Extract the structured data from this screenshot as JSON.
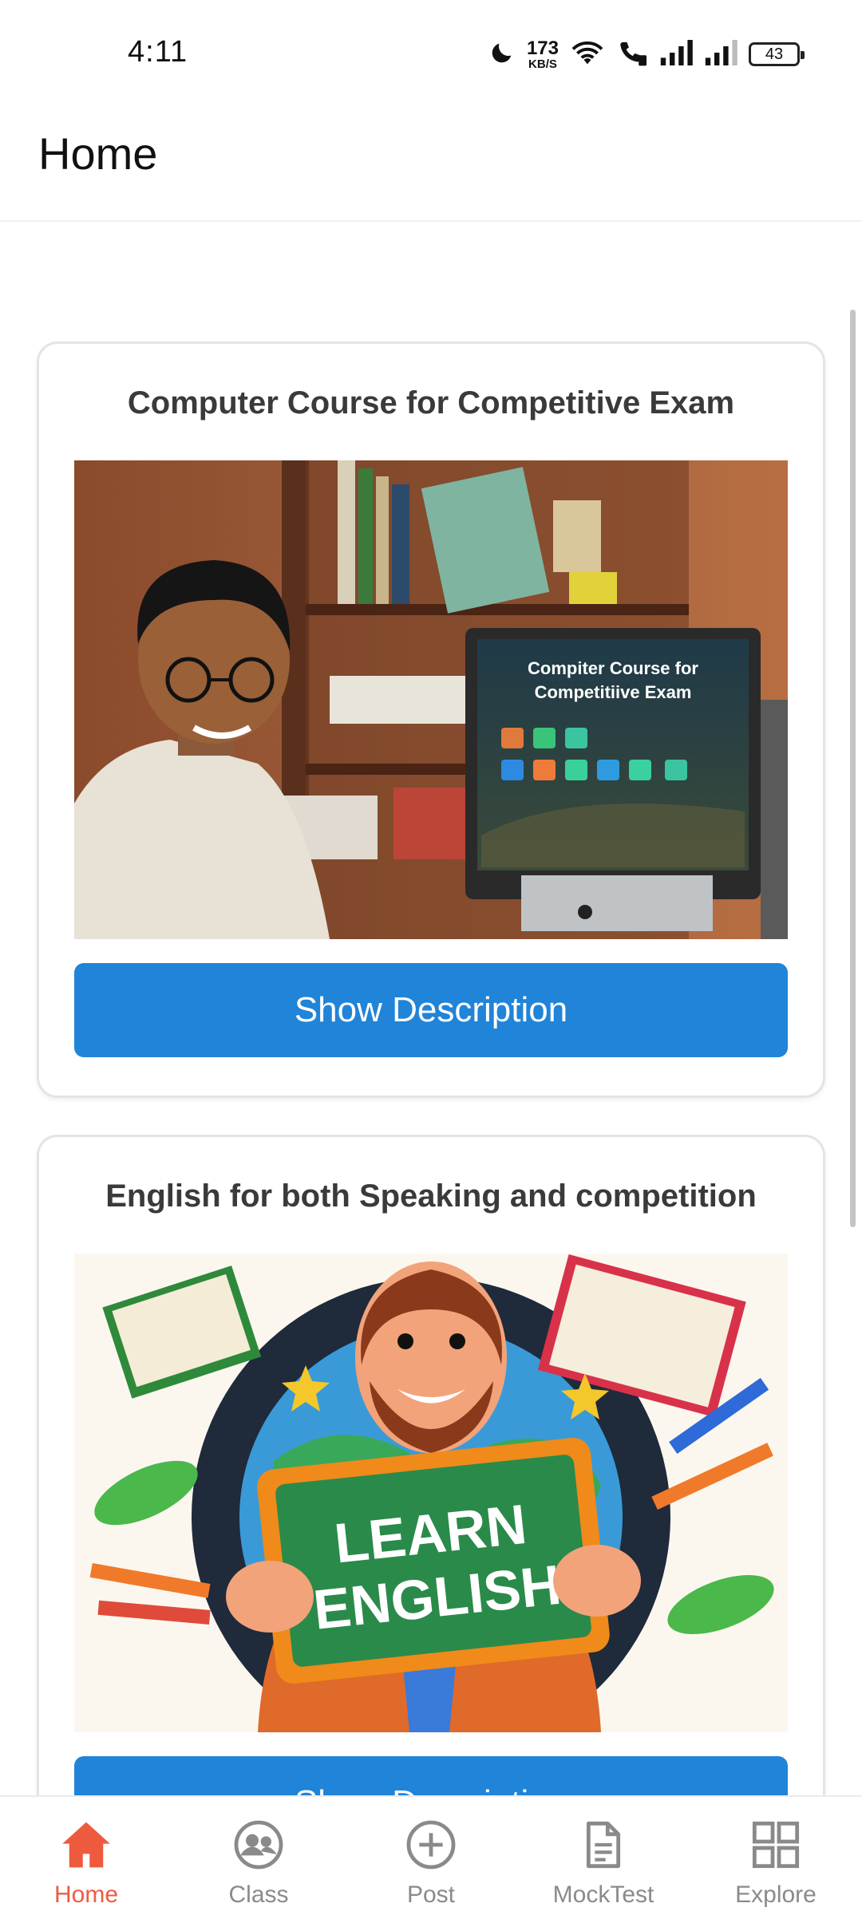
{
  "status_bar": {
    "time": "4:11",
    "net_speed_value": "173",
    "net_speed_unit": "KB/S",
    "battery": "43",
    "icons": [
      "moon-icon",
      "wifi-icon",
      "call-icon",
      "signal-icon",
      "signal-icon",
      "battery-icon"
    ]
  },
  "header": {
    "title": "Home"
  },
  "courses": [
    {
      "title": "Computer Course for Competitive Exam",
      "image_screen_text_1": "Compiter Course for",
      "image_screen_text_2": "Competitiive Exam",
      "button_label": "Show Description"
    },
    {
      "title": "English for both Speaking and  competition",
      "image_board_text_1": "LEARN",
      "image_board_text_2": "ENGLISH",
      "button_label": "Show Description"
    }
  ],
  "bottom_nav": {
    "items": [
      {
        "label": "Home",
        "icon": "home-icon",
        "active": true
      },
      {
        "label": "Class",
        "icon": "class-icon",
        "active": false
      },
      {
        "label": "Post",
        "icon": "plus-circle-icon",
        "active": false
      },
      {
        "label": "MockTest",
        "icon": "document-icon",
        "active": false
      },
      {
        "label": "Explore",
        "icon": "grid-icon",
        "active": false
      }
    ]
  },
  "colors": {
    "primary_button": "#2084d8",
    "active_nav": "#ee5a3e",
    "inactive_nav": "#8a8a8a"
  }
}
